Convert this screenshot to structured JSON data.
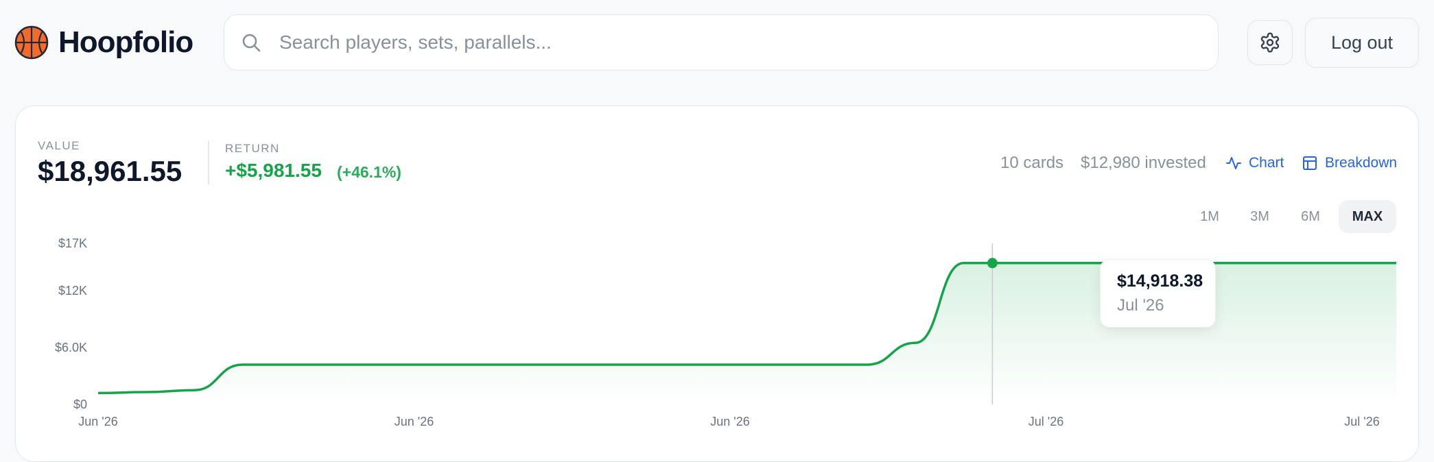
{
  "header": {
    "brand": "Hoopfolio",
    "search_placeholder": "Search players, sets, parallels...",
    "logout_label": "Log out"
  },
  "summary": {
    "value_label": "VALUE",
    "value": "$18,961.55",
    "return_label": "RETURN",
    "return_amount": "+$5,981.55",
    "return_percent": "(+46.1%)",
    "cards": "10 cards",
    "invested": "$12,980 invested",
    "chart_link": "Chart",
    "breakdown_link": "Breakdown"
  },
  "ranges": [
    {
      "label": "1M",
      "active": false
    },
    {
      "label": "3M",
      "active": false
    },
    {
      "label": "6M",
      "active": false
    },
    {
      "label": "MAX",
      "active": true
    }
  ],
  "tooltip": {
    "value": "$14,918.38",
    "date": "Jul '26"
  },
  "colors": {
    "accent": "#16a34a",
    "link": "#2563eb",
    "brand_ball": "#f26b2d"
  },
  "chart_data": {
    "type": "area",
    "y_ticks": [
      "$0",
      "$6.0K",
      "$12K",
      "$17K"
    ],
    "y_tick_values": [
      0,
      6000,
      12000,
      17000
    ],
    "x_ticks": [
      "Jun '26",
      "Jun '26",
      "Jun '26",
      "Jul '26",
      "Jul '26"
    ],
    "ylim": [
      0,
      17000
    ],
    "grid": false,
    "series": [
      {
        "values": [
          1200,
          1300,
          1500,
          4200,
          4200,
          4200,
          4200,
          4200,
          4200,
          4200,
          4200,
          4200,
          4200,
          4200,
          4200,
          4200,
          4200,
          6500,
          14918.38,
          14918.38,
          14918.38,
          14918.38,
          14918.38,
          14918.38,
          14918.38,
          14918.38,
          14918.38,
          14918.38
        ]
      }
    ]
  }
}
